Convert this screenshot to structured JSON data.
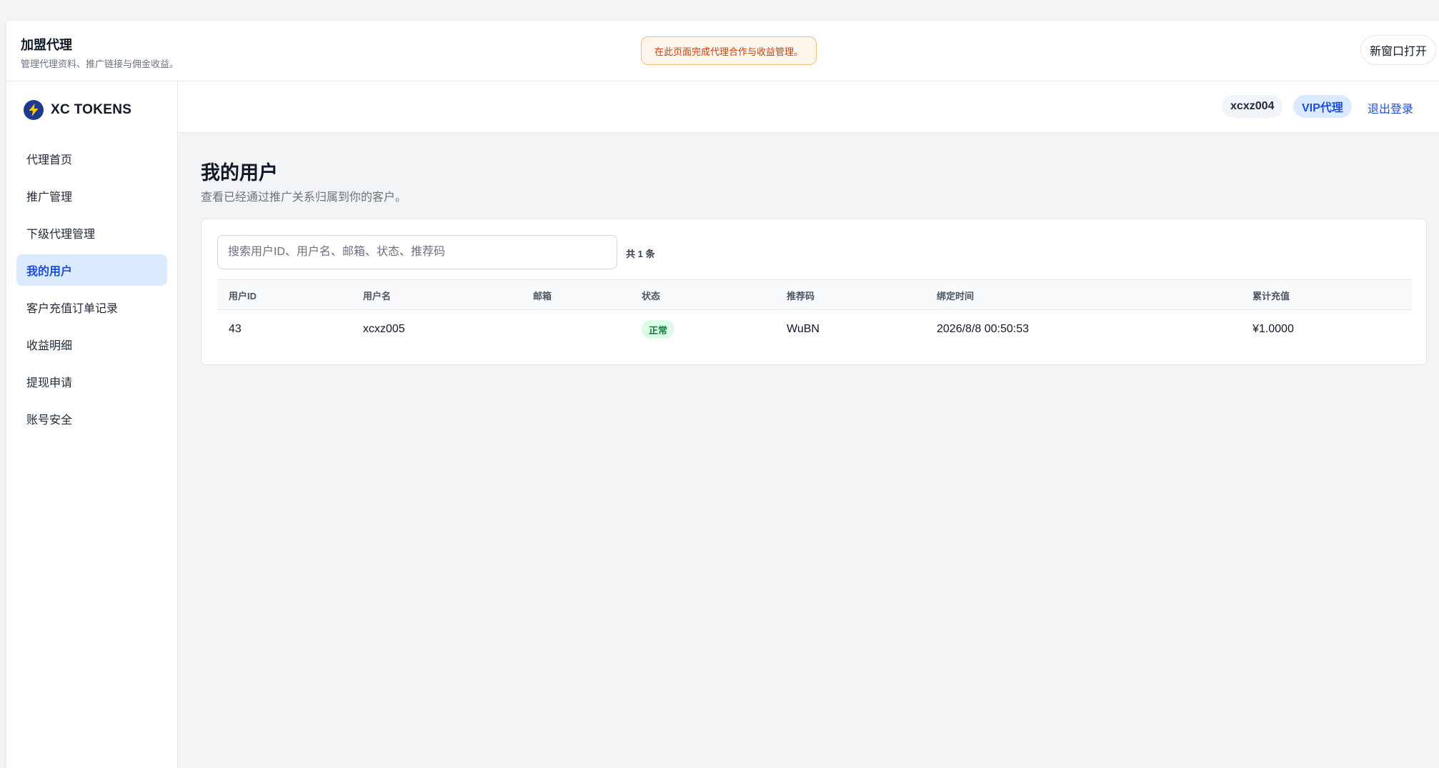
{
  "header": {
    "title": "加盟代理",
    "subtitle": "管理代理资料、推广链接与佣金收益。",
    "notice": "在此页面完成代理合作与收益管理。",
    "open_new_window": "新窗口打开"
  },
  "brand": {
    "name": "XC TOKENS",
    "logo_icon": "lightning-icon",
    "logo_color": "#1e3a8a",
    "bolt_color": "#facc15"
  },
  "sidebar": {
    "items": [
      {
        "label": "代理首页",
        "active": false
      },
      {
        "label": "推广管理",
        "active": false
      },
      {
        "label": "下级代理管理",
        "active": false
      },
      {
        "label": "我的用户",
        "active": true
      },
      {
        "label": "客户充值订单记录",
        "active": false
      },
      {
        "label": "收益明细",
        "active": false
      },
      {
        "label": "提现申请",
        "active": false
      },
      {
        "label": "账号安全",
        "active": false
      }
    ]
  },
  "account": {
    "username": "xcxz004",
    "level": "VIP代理",
    "logout": "退出登录"
  },
  "page": {
    "title": "我的用户",
    "subtitle": "查看已经通过推广关系归属到你的客户。"
  },
  "search": {
    "placeholder": "搜索用户ID、用户名、邮箱、状态、推荐码",
    "value": "",
    "count": "共 1 条"
  },
  "table": {
    "columns": [
      "用户ID",
      "用户名",
      "邮箱",
      "状态",
      "推荐码",
      "绑定时间",
      "累计充值"
    ],
    "rows": [
      {
        "id": "43",
        "username": "xcxz005",
        "email": "",
        "status": "正常",
        "referral_code": "WuBN",
        "bind_time": "2026/8/8 00:50:53",
        "total_recharge": "¥1.0000"
      }
    ]
  },
  "colors": {
    "accent": "#1d4ed8",
    "active_bg": "#dbeafe",
    "status_ok_bg": "#dcfce7",
    "status_ok_text": "#15803d",
    "notice_bg": "#fff7ed",
    "notice_border": "#fdba74"
  }
}
